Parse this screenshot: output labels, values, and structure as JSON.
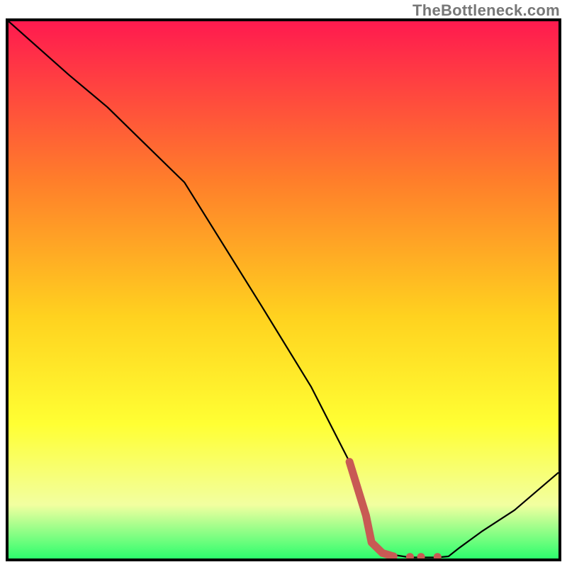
{
  "watermark": "TheBottleneck.com",
  "colors": {
    "gradient_top": "#ff1a4f",
    "gradient_mid1": "#ff7f2a",
    "gradient_mid2": "#ffd21f",
    "gradient_mid3": "#ffff33",
    "gradient_mid4": "#f2ffa0",
    "gradient_bottom": "#2dfd6d",
    "curve": "#000000",
    "marker": "#c85a54",
    "border": "#000000"
  },
  "chart_data": {
    "type": "line",
    "title": "",
    "xlabel": "",
    "ylabel": "",
    "xlim": [
      0,
      100
    ],
    "ylim": [
      0,
      100
    ],
    "series": [
      {
        "name": "bottleneck-curve",
        "x": [
          0,
          11,
          18,
          24,
          32,
          46,
          55,
          62,
          65,
          66,
          68,
          73,
          78,
          80,
          82,
          86,
          92,
          100
        ],
        "y": [
          100,
          90,
          84,
          78,
          70,
          47,
          32,
          18,
          8,
          3,
          1,
          0.2,
          0.2,
          0.4,
          2,
          5,
          9,
          16
        ]
      }
    ],
    "markers": {
      "name": "highlight-dots",
      "style": "thick-red-segment-and-dots",
      "segment": {
        "x": [
          62,
          65,
          66,
          68,
          70
        ],
        "y": [
          18,
          8,
          3,
          1,
          0.4
        ]
      },
      "dots": [
        {
          "x": 70,
          "y": 0.4
        },
        {
          "x": 73,
          "y": 0.3
        },
        {
          "x": 75,
          "y": 0.3
        },
        {
          "x": 78,
          "y": 0.3
        }
      ]
    }
  }
}
